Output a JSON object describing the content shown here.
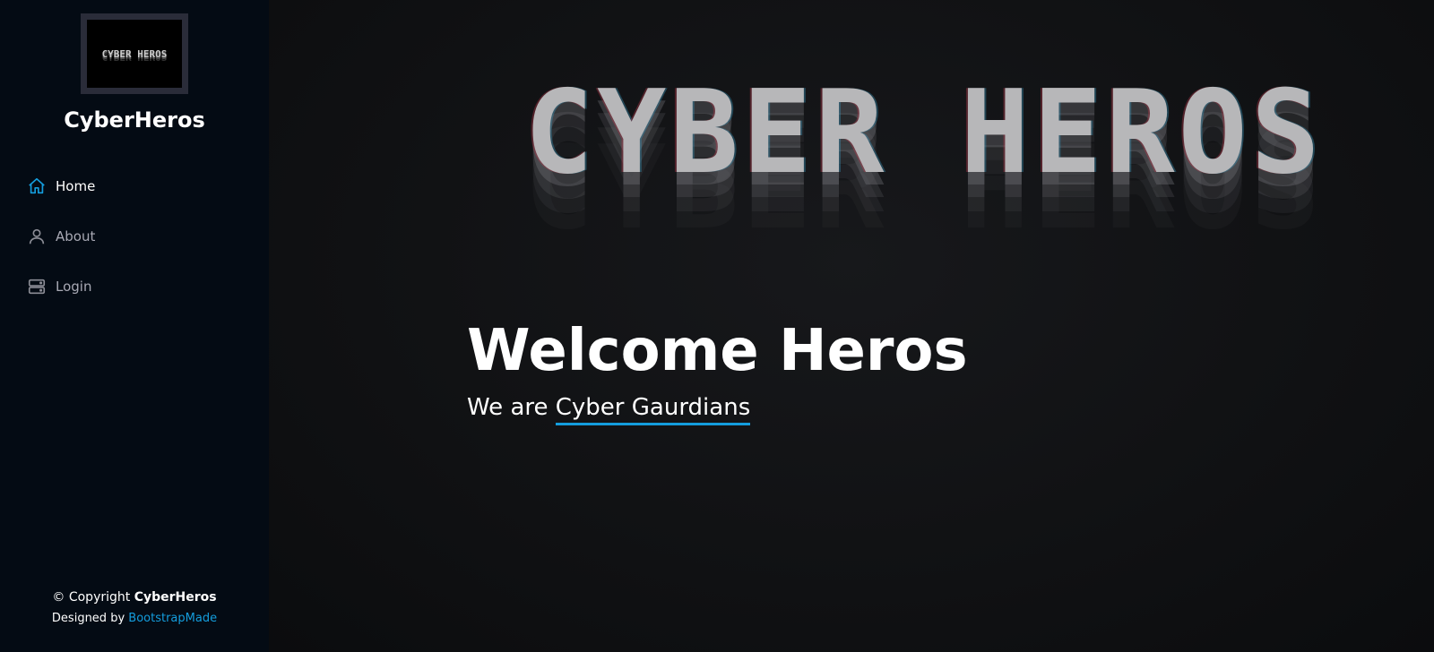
{
  "sidebar": {
    "logo_text": "CYBER HEROS",
    "site_name": "CyberHeros",
    "nav": [
      {
        "label": "Home",
        "icon": "home-icon",
        "active": true
      },
      {
        "label": "About",
        "icon": "person-icon",
        "active": false
      },
      {
        "label": "Login",
        "icon": "server-icon",
        "active": false
      }
    ],
    "footer": {
      "copyright_prefix": "© Copyright ",
      "copyright_brand": "CyberHeros",
      "designed_prefix": "Designed by ",
      "designed_link": "BootstrapMade"
    }
  },
  "hero": {
    "banner_text": "CYBER HEROS",
    "title": "Welcome Heros",
    "subtitle_prefix": "We are ",
    "subtitle_typed": "Cyber Gaurdians"
  },
  "colors": {
    "accent": "#149ddd",
    "sidebar_bg": "#040b14",
    "main_bg": "#101113"
  }
}
